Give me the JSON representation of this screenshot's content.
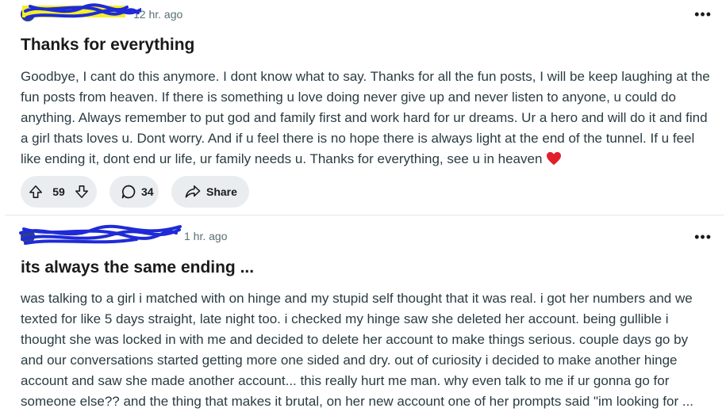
{
  "posts": [
    {
      "time": "12 hr. ago",
      "more_label": "•••",
      "title": "Thanks for everything",
      "body": "Goodbye, I cant do this anymore. I dont know what to say. Thanks for all the fun posts, I will be keep laughing at the fun posts from heaven. If there is something u love doing never give up and never listen to anyone, u could do anything. Always remember to put god and family first and work hard for ur dreams. Ur a hero and will do it and find a girl thats loves u. Dont worry. And if u feel there is no hope there is always light at the end of the tunnel. If u feel like ending it, dont end ur life, ur family needs u. Thanks for everything, see u in heaven",
      "upvotes": "59",
      "comments": "34",
      "share_label": "Share"
    },
    {
      "time": "1 hr. ago",
      "more_label": "•••",
      "title": "its always the same ending ...",
      "body": "was talking to a girl i matched with on hinge and my stupid self thought that it was real. i got her numbers and we texted for like 5 days straight, late night too. i checked my hinge saw she deleted her account. being gullible i thought she was locked in with me and decided to delete her account to make things serious. couple days go by and our conversations started getting more one sided and dry. out of curiosity i decided to make another hinge account and saw she made another account... this really hurt me man. why even talk to me if ur gonna go for someone else?? and the thing that makes it brutal, on her new account one of her prompts said \"im looking for ..."
    }
  ],
  "colors": {
    "scribble_blue": "#1f2bd6",
    "highlight_yellow": "#f4ef2a",
    "heart_red": "#e0202b",
    "pill_bg": "#e9edef"
  }
}
